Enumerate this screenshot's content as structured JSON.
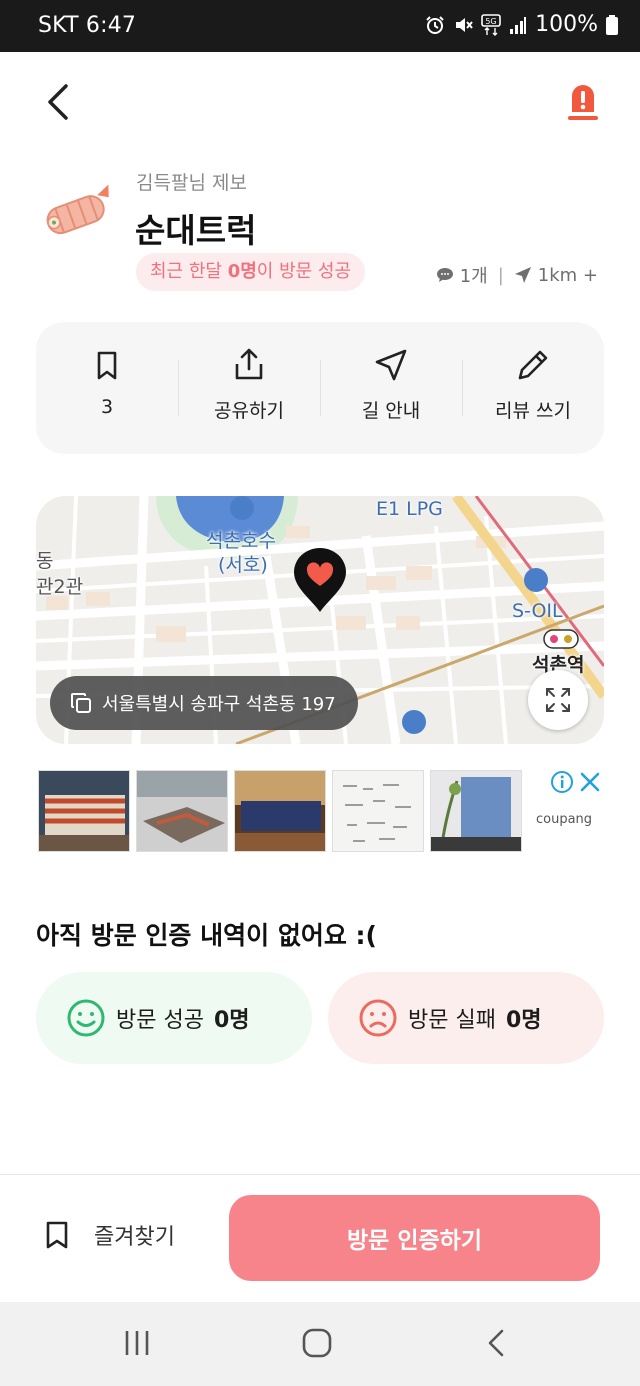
{
  "status_bar": {
    "carrier_time": "SKT 6:47",
    "battery": "100%",
    "icons": [
      "alarm-icon",
      "mute-icon",
      "5g-icon",
      "signal-icon",
      "battery-icon"
    ]
  },
  "header": {
    "back_icon": "chevron-left-icon",
    "report_icon": "alert-icon",
    "accent_color": "#f2583e"
  },
  "store": {
    "reporter": "김득팔님 제보",
    "name": "순대트럭",
    "visit_badge_prefix": "최근 한달 ",
    "visit_badge_count": "0명",
    "visit_badge_suffix": "이 방문 성공",
    "review_count": "1개",
    "distance": "1km +"
  },
  "actions": [
    {
      "icon": "bookmark-icon",
      "label": "3"
    },
    {
      "icon": "share-icon",
      "label": "공유하기"
    },
    {
      "icon": "navigation-icon",
      "label": "길 안내"
    },
    {
      "icon": "pencil-icon",
      "label": "리뷰 쓰기"
    }
  ],
  "map": {
    "labels": {
      "lake": "석촌호수",
      "lake_sub": "(서호)",
      "gas1": "E1 LPG",
      "gas2": "S-OIL",
      "station": "석촌역",
      "left_edge_1": "동",
      "left_edge_2": "관2관"
    },
    "address": "서울특별시 송파구 석촌동 197",
    "marker_icon": "heart-marker-icon",
    "expand_icon": "expand-icon"
  },
  "ad": {
    "brand": "coupang",
    "info_icon": "info-icon",
    "close_icon": "close-icon"
  },
  "visits": {
    "title": "아직 방문 인증 내역이 없어요 :(",
    "success_label": "방문 성공",
    "success_count": "0명",
    "fail_label": "방문 실패",
    "fail_count": "0명",
    "success_color": "#2eb872",
    "fail_color": "#ee6a5c"
  },
  "bottom": {
    "favorite_label": "즐겨찾기",
    "verify_label": "방문 인증하기",
    "verify_color": "#f7848b"
  },
  "nav": {
    "icons": [
      "recent-apps-icon",
      "home-icon",
      "back-nav-icon"
    ]
  }
}
